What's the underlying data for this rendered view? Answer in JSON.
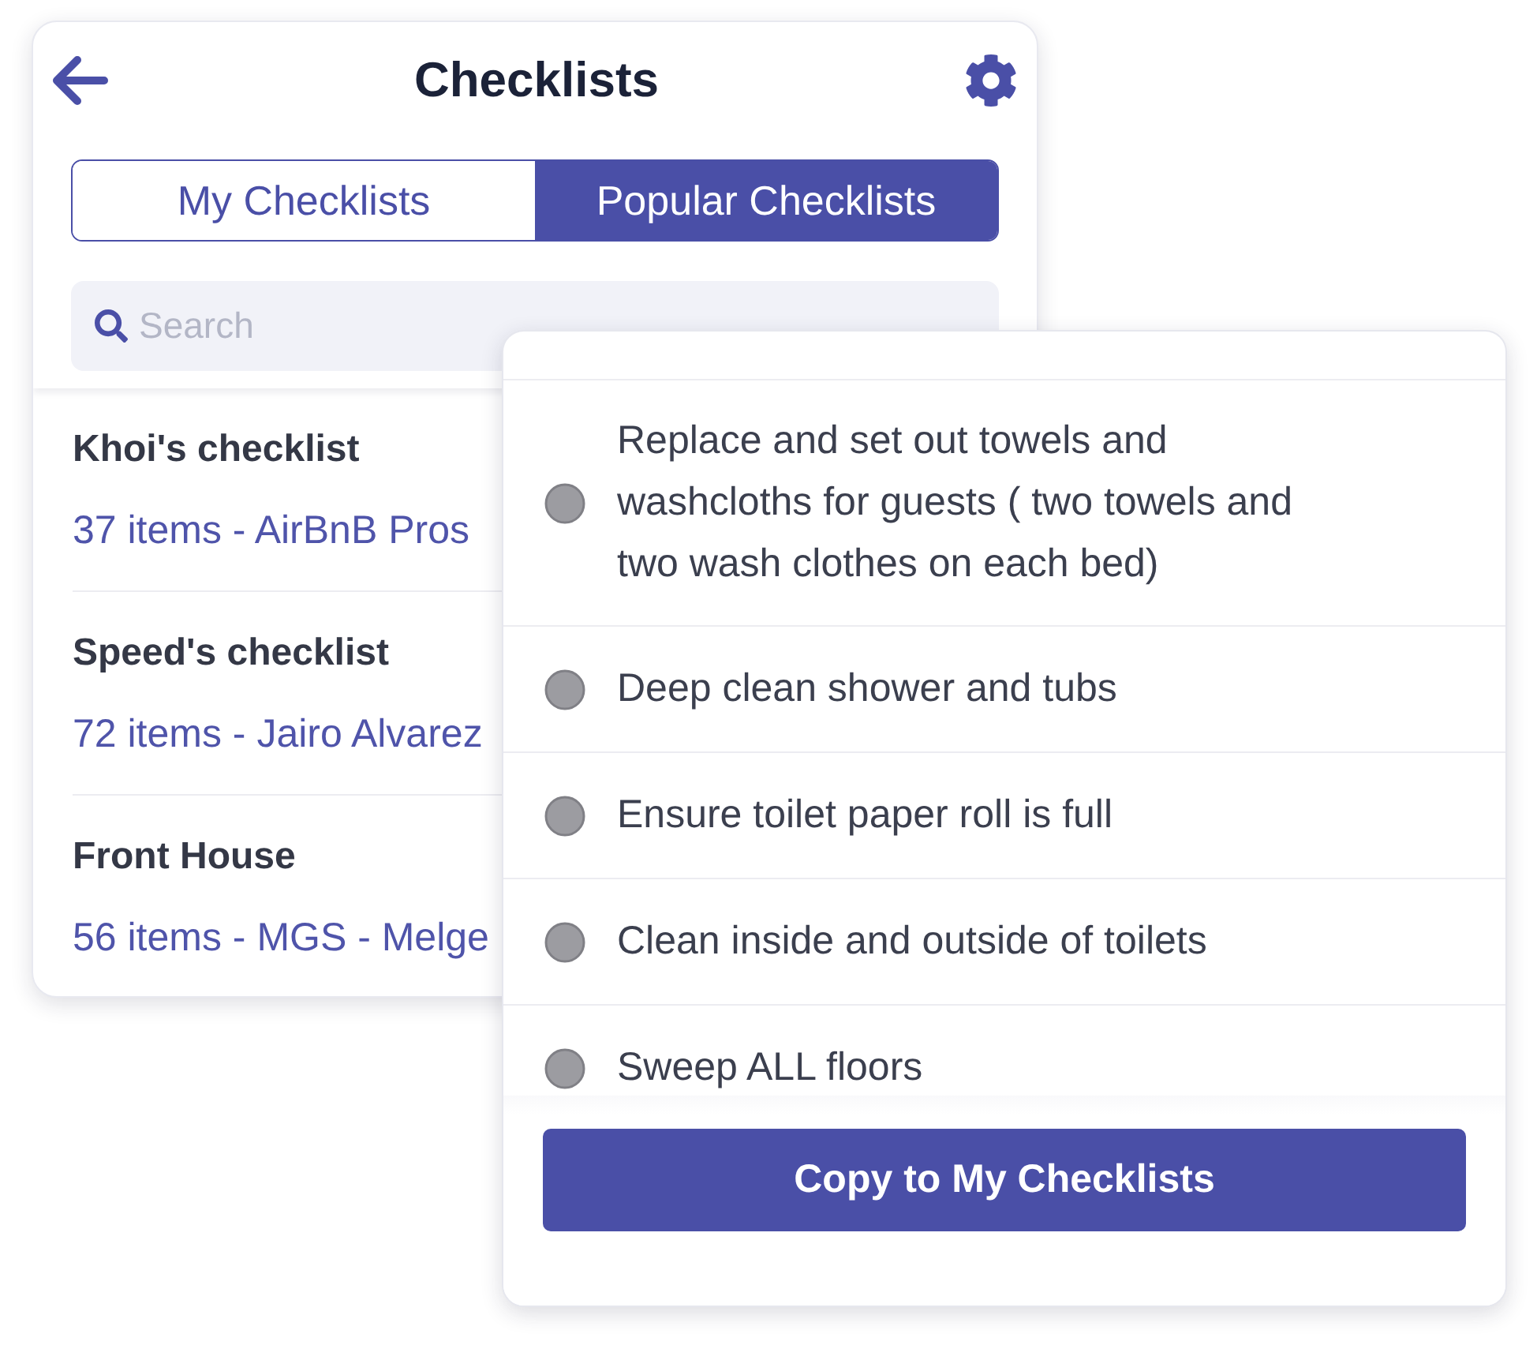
{
  "header": {
    "title": "Checklists"
  },
  "tabs": [
    {
      "label": "My Checklists",
      "selected": false
    },
    {
      "label": "Popular Checklists",
      "selected": true
    }
  ],
  "search": {
    "placeholder": "Search"
  },
  "checklists": [
    {
      "name": "Khoi's checklist",
      "meta": "37 items - AirBnB Pros"
    },
    {
      "name": "Speed's checklist",
      "meta": "72 items - Jairo Alvarez"
    },
    {
      "name": "Front House",
      "meta": "56 items - MGS - Melge"
    }
  ],
  "detail": {
    "items": [
      {
        "text": "Replace and set out towels and washcloths for guests ( two towels and two wash clothes on each bed)",
        "checked": false
      },
      {
        "text": "Deep clean shower and tubs",
        "checked": false
      },
      {
        "text": "Ensure toilet paper roll is full",
        "checked": false
      },
      {
        "text": "Clean inside and outside of toilets",
        "checked": false
      },
      {
        "text": "Sweep ALL floors",
        "checked": false
      }
    ],
    "button": "Copy to My Checklists"
  }
}
